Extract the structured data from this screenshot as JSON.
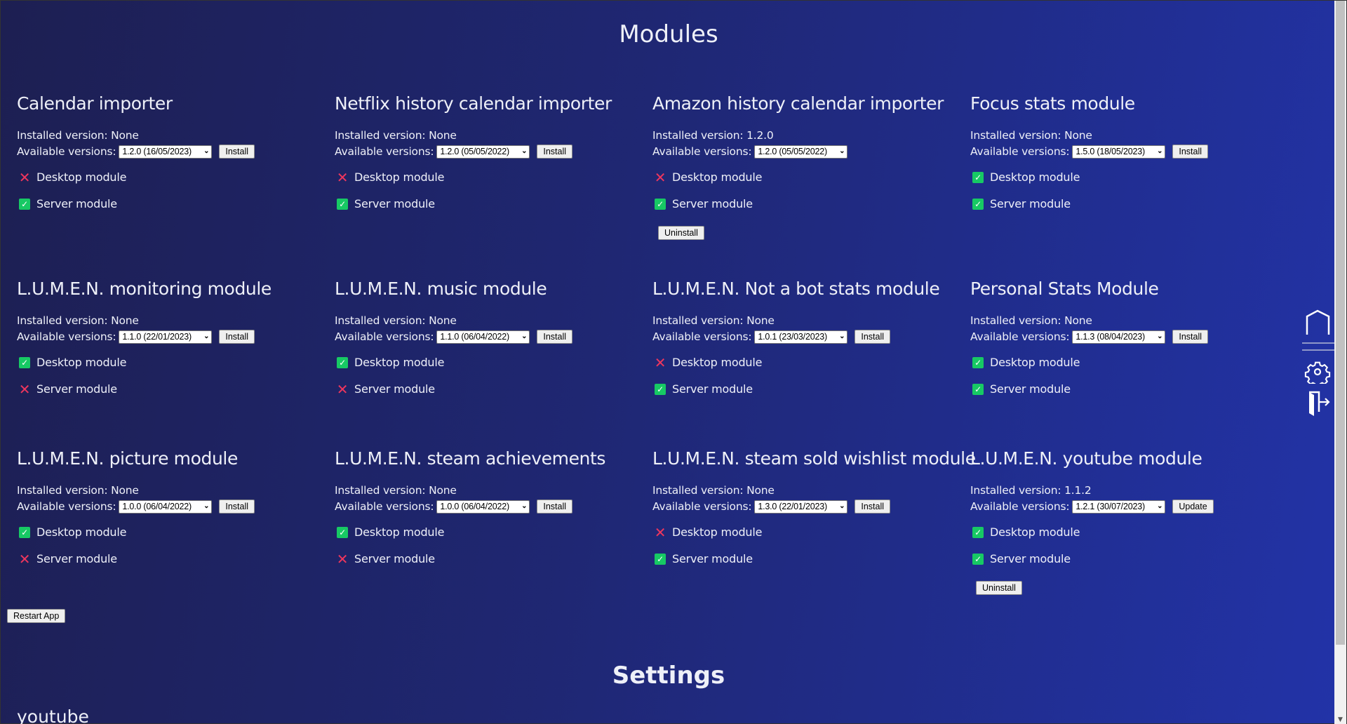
{
  "page_title": "Modules",
  "labels": {
    "installed": "Installed version: ",
    "available": "Available versions:",
    "desktop": "Desktop module",
    "server": "Server module",
    "uninstall": "Uninstall"
  },
  "modules": [
    {
      "name": "Calendar importer",
      "installed": "None",
      "version": "1.2.0 (16/05/2023)",
      "action": "Install",
      "desktop": false,
      "server": true,
      "uninstall": false
    },
    {
      "name": "Netflix history calendar importer",
      "installed": "None",
      "version": "1.2.0 (05/05/2022)",
      "action": "Install",
      "desktop": false,
      "server": true,
      "uninstall": false
    },
    {
      "name": "Amazon history calendar importer",
      "installed": "1.2.0",
      "version": "1.2.0 (05/05/2022)",
      "action": null,
      "desktop": false,
      "server": true,
      "uninstall": true
    },
    {
      "name": "Focus stats module",
      "installed": "None",
      "version": "1.5.0 (18/05/2023)",
      "action": "Install",
      "desktop": true,
      "server": true,
      "uninstall": false
    },
    {
      "name": "L.U.M.E.N. monitoring module",
      "installed": "None",
      "version": "1.1.0 (22/01/2023)",
      "action": "Install",
      "desktop": true,
      "server": false,
      "uninstall": false
    },
    {
      "name": "L.U.M.E.N. music module",
      "installed": "None",
      "version": "1.1.0 (06/04/2022)",
      "action": "Install",
      "desktop": true,
      "server": false,
      "uninstall": false
    },
    {
      "name": "L.U.M.E.N. Not a bot stats module",
      "installed": "None",
      "version": "1.0.1 (23/03/2023)",
      "action": "Install",
      "desktop": false,
      "server": true,
      "uninstall": false
    },
    {
      "name": "Personal Stats Module",
      "installed": "None",
      "version": "1.1.3 (08/04/2023)",
      "action": "Install",
      "desktop": true,
      "server": true,
      "uninstall": false
    },
    {
      "name": "L.U.M.E.N. picture module",
      "installed": "None",
      "version": "1.0.0 (06/04/2022)",
      "action": "Install",
      "desktop": true,
      "server": false,
      "uninstall": false
    },
    {
      "name": "L.U.M.E.N. steam achievements",
      "installed": "None",
      "version": "1.0.0 (06/04/2022)",
      "action": "Install",
      "desktop": true,
      "server": false,
      "uninstall": false
    },
    {
      "name": "L.U.M.E.N. steam sold wishlist module",
      "installed": "None",
      "version": "1.3.0 (22/01/2023)",
      "action": "Install",
      "desktop": false,
      "server": true,
      "uninstall": false
    },
    {
      "name": "L.U.M.E.N. youtube module",
      "installed": "1.1.2",
      "version": "1.2.1 (30/07/2023)",
      "action": "Update",
      "desktop": true,
      "server": true,
      "uninstall": true
    }
  ],
  "restart_label": "Restart App",
  "settings_title": "Settings",
  "settings_section": "youtube",
  "sidebar": {
    "icons": [
      "home-icon",
      "settings-icon",
      "logout-icon"
    ]
  },
  "colors": {
    "ok": "#17c964",
    "error": "#f0365d",
    "bg_start": "#1d1f52",
    "bg_end": "#2233a8"
  }
}
